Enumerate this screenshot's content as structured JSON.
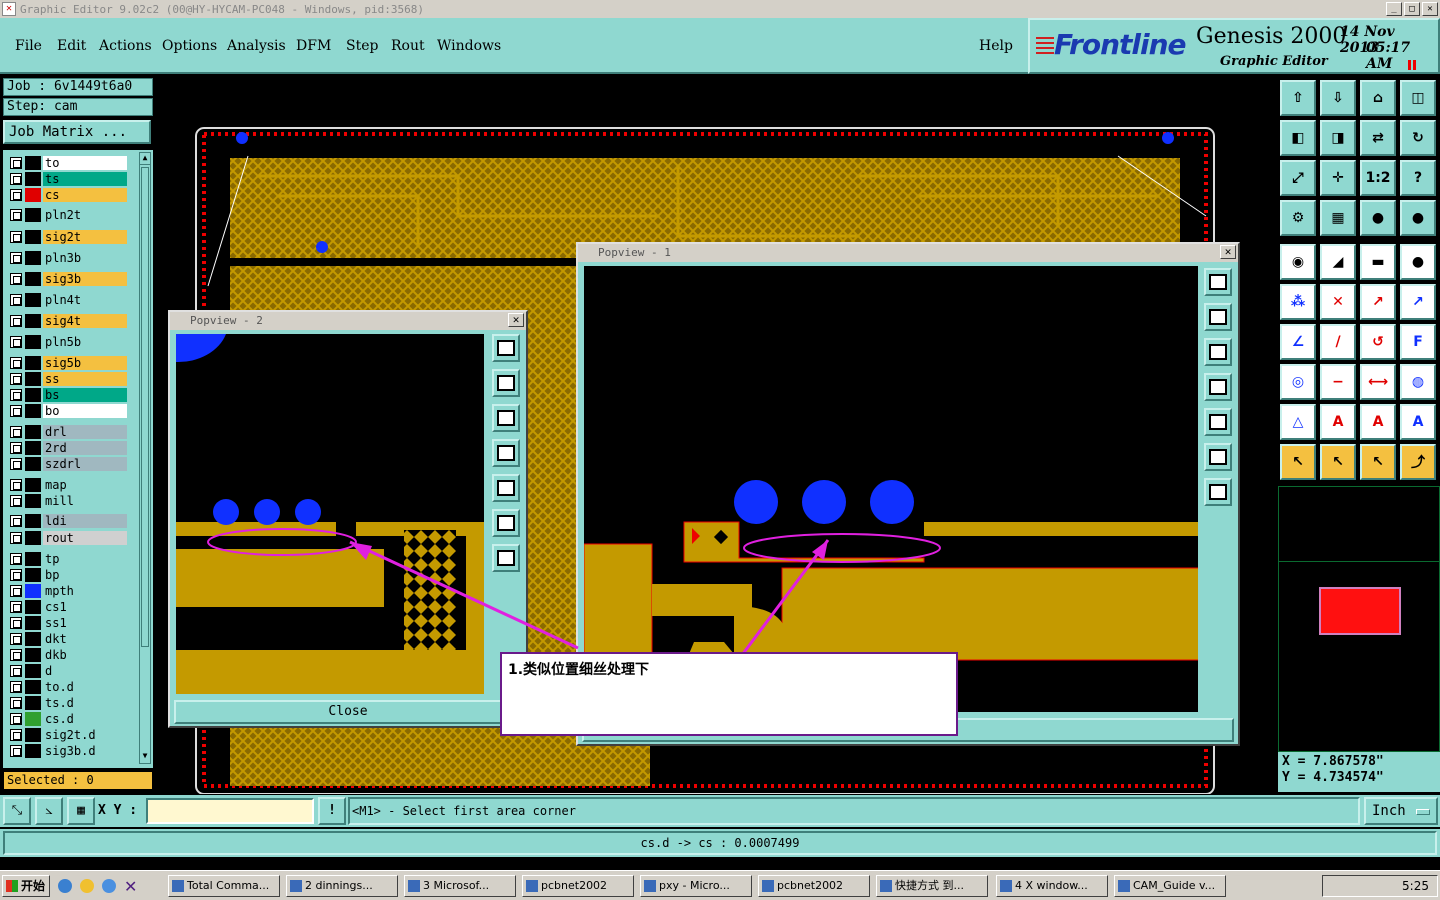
{
  "window": {
    "title": "Graphic Editor 9.02c2 (00@HY-HYCAM-PC048 - Windows, pid:3568)"
  },
  "menu": {
    "items": [
      "File",
      "Edit",
      "Actions",
      "Options",
      "Analysis",
      "DFM",
      "Step",
      "Rout",
      "Windows"
    ],
    "help": "Help"
  },
  "brand": {
    "logo": "Frontline",
    "product": "Genesis 2000",
    "subtitle": "Graphic Editor",
    "date": "14 Nov 2013",
    "time": "05:17 AM"
  },
  "job": {
    "job_label": "Job : 6v1449t6a0",
    "step_label": "Step: cam",
    "matrix_button": "Job Matrix ..."
  },
  "layers": [
    {
      "name": "to",
      "color": "#ffffff",
      "sw": "#000000"
    },
    {
      "name": "ts",
      "color": "#00a888",
      "sw": "#000000"
    },
    {
      "name": "cs",
      "color": "#f4c040",
      "sw": "#e00000"
    },
    {
      "name": "pln2t",
      "color": "#8fd8d0",
      "sw": "#000000"
    },
    {
      "name": "sig2t",
      "color": "#f4c040",
      "sw": "#000000"
    },
    {
      "name": "pln3b",
      "color": "#8fd8d0",
      "sw": "#000000"
    },
    {
      "name": "sig3b",
      "color": "#f4c040",
      "sw": "#000000"
    },
    {
      "name": "pln4t",
      "color": "#8fd8d0",
      "sw": "#000000"
    },
    {
      "name": "sig4t",
      "color": "#f4c040",
      "sw": "#000000"
    },
    {
      "name": "pln5b",
      "color": "#8fd8d0",
      "sw": "#000000"
    },
    {
      "name": "sig5b",
      "color": "#f4c040",
      "sw": "#000000"
    },
    {
      "name": "ss",
      "color": "#f4c040",
      "sw": "#000000"
    },
    {
      "name": "bs",
      "color": "#00a888",
      "sw": "#000000"
    },
    {
      "name": "bo",
      "color": "#ffffff",
      "sw": "#000000"
    },
    {
      "name": "drl",
      "color": "#a0b8c0",
      "sw": "#000000"
    },
    {
      "name": "2rd",
      "color": "#a0b8c0",
      "sw": "#000000"
    },
    {
      "name": "szdrl",
      "color": "#a0b8c0",
      "sw": "#000000"
    },
    {
      "name": "map",
      "color": "#8fd8d0",
      "sw": "#000000"
    },
    {
      "name": "mill",
      "color": "#8fd8d0",
      "sw": "#000000"
    },
    {
      "name": "ldi",
      "color": "#a0b8c0",
      "sw": "#000000"
    },
    {
      "name": "rout",
      "color": "#d0d0d0",
      "sw": "#000000"
    },
    {
      "name": "tp",
      "color": "#8fd8d0",
      "sw": "#000000"
    },
    {
      "name": "bp",
      "color": "#8fd8d0",
      "sw": "#000000"
    },
    {
      "name": "mpth",
      "color": "#8fd8d0",
      "sw": "#1030ff"
    },
    {
      "name": "cs1",
      "color": "#8fd8d0",
      "sw": "#000000"
    },
    {
      "name": "ss1",
      "color": "#8fd8d0",
      "sw": "#000000"
    },
    {
      "name": "dkt",
      "color": "#8fd8d0",
      "sw": "#000000"
    },
    {
      "name": "dkb",
      "color": "#8fd8d0",
      "sw": "#000000"
    },
    {
      "name": "d",
      "color": "#8fd8d0",
      "sw": "#000000"
    },
    {
      "name": "to.d",
      "color": "#8fd8d0",
      "sw": "#000000"
    },
    {
      "name": "ts.d",
      "color": "#8fd8d0",
      "sw": "#000000"
    },
    {
      "name": "cs.d",
      "color": "#8fd8d0",
      "sw": "#30a030"
    },
    {
      "name": "sig2t.d",
      "color": "#8fd8d0",
      "sw": "#000000"
    },
    {
      "name": "sig3b.d",
      "color": "#8fd8d0",
      "sw": "#000000"
    }
  ],
  "selected": "Selected : 0",
  "popview2": {
    "title": "Popview - 2",
    "close": "Close"
  },
  "popview1": {
    "title": "Popview - 1"
  },
  "callout": {
    "text": "1.类似位置细丝处理下"
  },
  "coords": {
    "x": "X = 7.867578\"",
    "y": "Y = 4.734574\""
  },
  "cmd": {
    "xy_label": "X Y :",
    "xy_value": "",
    "prompt": "<M1> - Select first area corner",
    "units": "Inch"
  },
  "status": {
    "text": "cs.d -> cs : 0.0007499"
  },
  "taskbar": {
    "start": "开始",
    "tasks": [
      "Total Comma...",
      "2 dinnings...",
      "3 Microsof...",
      "pcbnet2002",
      "pxy - Micro...",
      "pcbnet2002",
      "快捷方式 到...",
      "4 X window...",
      "CAM_Guide v..."
    ],
    "clock": "5:25"
  },
  "colors": {
    "panel": "#8fd8d0",
    "copper": "#c49a00",
    "pad": "#1030ff",
    "highlight": "#e020e0"
  }
}
